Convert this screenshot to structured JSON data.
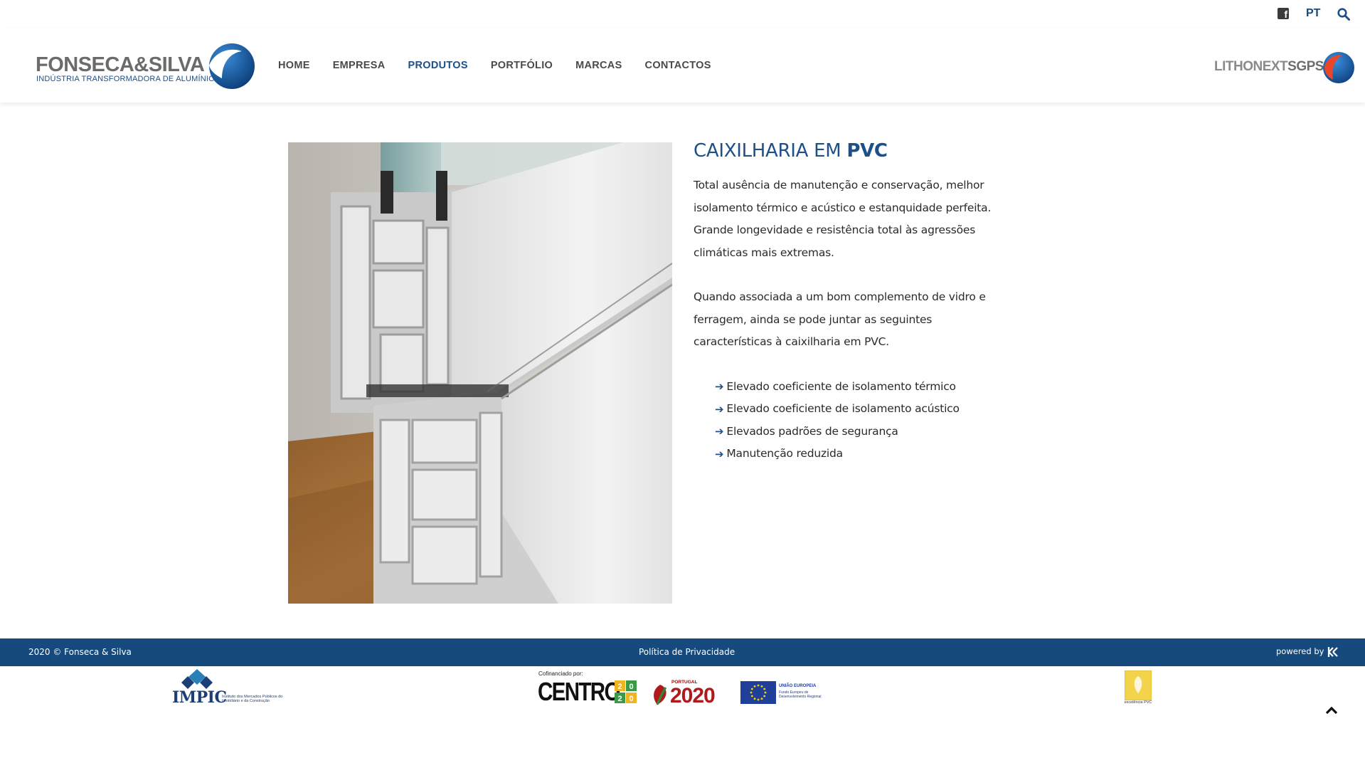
{
  "topbar": {
    "facebook_icon": "facebook-icon",
    "language": "PT",
    "search_icon": "search-icon"
  },
  "header": {
    "logo": {
      "brand": "FONSECA&SILVA",
      "tagline": "INDÚSTRIA TRANSFORMADORA DE ALUMÍNIO"
    },
    "nav": [
      {
        "label": "HOME",
        "active": false
      },
      {
        "label": "EMPRESA",
        "active": false
      },
      {
        "label": "PRODUTOS",
        "active": true
      },
      {
        "label": "PORTFÓLIO",
        "active": false
      },
      {
        "label": "MARCAS",
        "active": false
      },
      {
        "label": "CONTACTOS",
        "active": false
      }
    ],
    "partner_logo": {
      "light": "LITHONEXT",
      "bold": "SGPS"
    }
  },
  "main": {
    "title_normal": "CAIXILHARIA EM",
    "title_bold": "PVC",
    "paragraph_1": "Total ausência de manutenção e conservação, melhor isolamento térmico e acústico e estanquidade perfeita. Grande longevidade e resistência total às agressões climáticas mais extremas.",
    "paragraph_2": "Quando associada a um bom complemento de vidro e ferragem, ainda se pode juntar as seguintes características à caixilharia em PVC.",
    "features": [
      "Elevado coeficiente de isolamento térmico",
      "Elevado coeficiente de isolamento acústico",
      "Elevados padrões de segurança",
      "Manutenção reduzida"
    ]
  },
  "footer": {
    "copyright": "2020 © Fonseca & Silva",
    "privacy": "Política de Privacidade",
    "powered_by": "powered by",
    "impic": {
      "name": "IMPIC",
      "subtitle": "Instituto dos Mercados Públicos do Imobiliário e da Construção"
    },
    "centro": {
      "caption": "Cofinanciado por:",
      "name": "CENTRO"
    },
    "portugal2020": {
      "label": "PORTUGAL",
      "year": "2020"
    },
    "eu": {
      "title": "UNIÃO EUROPEIA",
      "subtitle": "Fundo Europeu de Desenvolvimento Regional"
    },
    "pvc_badge": {
      "caption": "excelência PVC"
    }
  },
  "colors": {
    "brand_blue": "#1d4f88",
    "footer_blue": "#174a7c"
  }
}
